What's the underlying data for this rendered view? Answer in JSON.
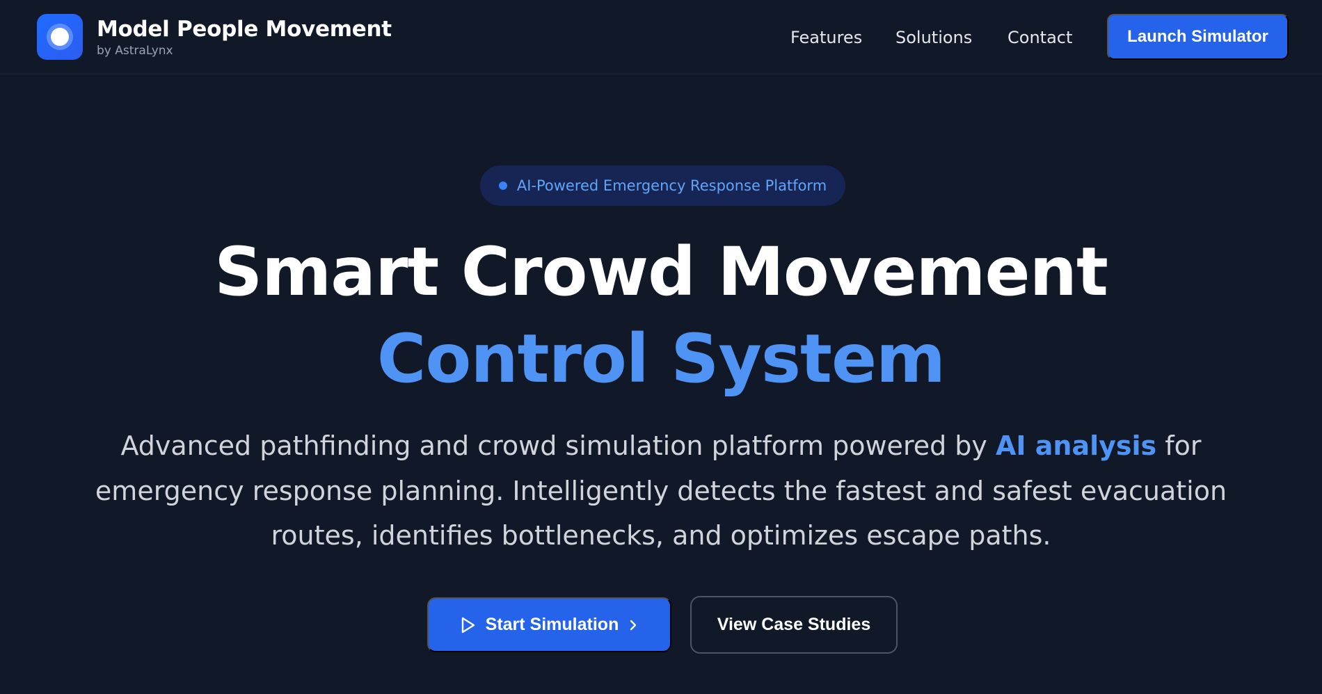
{
  "header": {
    "brand_title": "Model People Movement",
    "brand_subtitle": "by AstraLynx",
    "nav": {
      "features": "Features",
      "solutions": "Solutions",
      "contact": "Contact"
    },
    "launch_button": "Launch Simulator"
  },
  "hero": {
    "badge": "AI-Powered Emergency Response Platform",
    "headline_line1": "Smart Crowd Movement",
    "headline_line2": "Control System",
    "description": {
      "line1_before": "Advanced pathfinding and crowd simulation platform powered by ",
      "line1_highlight": "AI analysis",
      "line1_after": " for",
      "line2": "emergency response planning. Intelligently detects the fastest and safest evacuation",
      "line3": "routes, identifies bottlenecks, and optimizes escape paths."
    },
    "primary_button": "Start Simulation",
    "secondary_button": "View Case Studies"
  },
  "icons": {
    "logo": "target-icon",
    "play": "play-icon",
    "chevron": "chevron-right-icon"
  },
  "colors": {
    "background": "#111827",
    "accent": "#2563eb",
    "highlight": "#4f94f5",
    "badge_bg": "#172554"
  }
}
